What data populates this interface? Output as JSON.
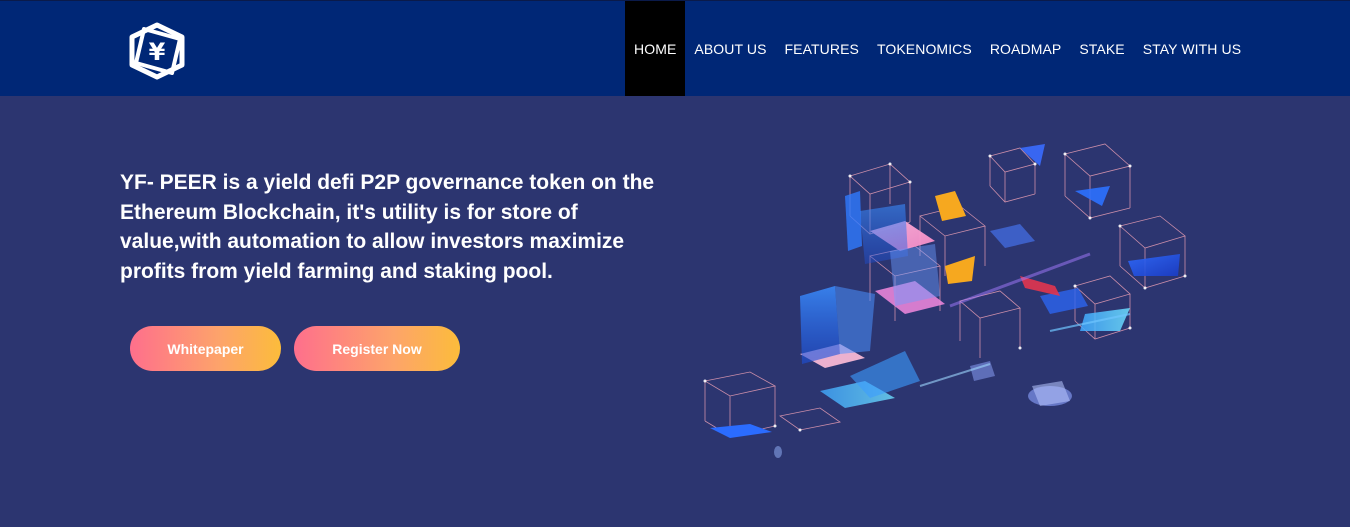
{
  "header": {
    "logo_icon": "yen-cube-logo-icon",
    "nav": [
      {
        "label": "HOME",
        "active": true
      },
      {
        "label": "ABOUT US",
        "active": false
      },
      {
        "label": "FEATURES",
        "active": false
      },
      {
        "label": "TOKENOMICS",
        "active": false
      },
      {
        "label": "ROADMAP",
        "active": false
      },
      {
        "label": "STAKE",
        "active": false
      },
      {
        "label": "STAY WITH US",
        "active": false
      }
    ]
  },
  "hero": {
    "text": "YF- PEER is a yield defi P2P governance token on the Ethereum Blockchain, it's utility is for store of value,with automation to allow investors maximize profits from yield farming and staking pool.",
    "buttons": {
      "whitepaper": "Whitepaper",
      "register": "Register Now"
    },
    "illustration": "blockchain-cubes-illustration"
  },
  "colors": {
    "header_bg": "#002776",
    "hero_bg": "#2c3570",
    "active_nav_bg": "#000000",
    "button_gradient_start": "#fe6f8c",
    "button_gradient_end": "#fcbc3b"
  }
}
